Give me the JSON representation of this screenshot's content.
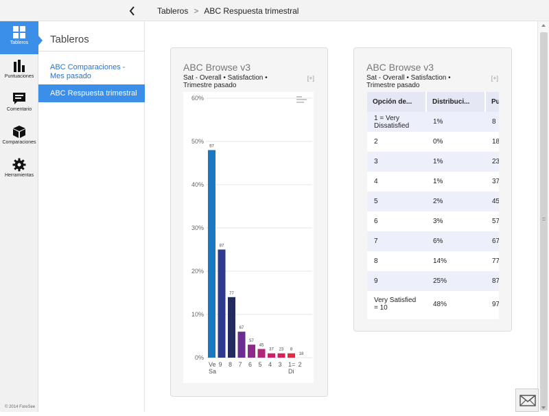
{
  "breadcrumb": {
    "root": "Tableros",
    "sep": ">",
    "current": "ABC Respuesta trimestral"
  },
  "iconbar": {
    "items": [
      {
        "label": "Tableros",
        "icon": "dashboard-icon"
      },
      {
        "label": "Puntuaciones",
        "icon": "bar-chart-icon"
      },
      {
        "label": "Comentario",
        "icon": "comment-icon"
      },
      {
        "label": "Comparaciones",
        "icon": "cube-icon"
      },
      {
        "label": "Herramientas",
        "icon": "gear-icon"
      }
    ],
    "copyright": "© 2014 ForeSee"
  },
  "subnav": {
    "title": "Tableros",
    "items": [
      {
        "label": "ABC Comparaciones - Mes pasado"
      },
      {
        "label": "ABC Respuesta trimestral"
      }
    ]
  },
  "cards": [
    {
      "title": "ABC Browse v3",
      "subtitle": "Sat - Overall • Satisfaction • Trimestre pasado",
      "expand": "[+]"
    },
    {
      "title": "ABC Browse v3",
      "subtitle": "Sat - Overall • Satisfaction • Trimestre pasado",
      "expand": "[+]"
    }
  ],
  "table": {
    "headers": [
      "Opción de...",
      "Distribuci...",
      "Pu"
    ],
    "rows": [
      [
        "1 = Very Dissatisfied",
        "1%",
        "8"
      ],
      [
        "2",
        "0%",
        "18"
      ],
      [
        "3",
        "1%",
        "23"
      ],
      [
        "4",
        "1%",
        "37"
      ],
      [
        "5",
        "2%",
        "45"
      ],
      [
        "6",
        "3%",
        "57"
      ],
      [
        "7",
        "6%",
        "67"
      ],
      [
        "8",
        "14%",
        "77"
      ],
      [
        "9",
        "25%",
        "87"
      ],
      [
        "Very Satisfied = 10",
        "48%",
        "97"
      ]
    ]
  },
  "chart_data": {
    "type": "bar",
    "categories": [
      "Very Satisfied = 10",
      "9",
      "8",
      "7",
      "6",
      "5",
      "4",
      "3",
      "1 = Very Dissatisfied",
      "2"
    ],
    "tick_labels": [
      [
        "Ve",
        "Sa"
      ],
      [
        "9"
      ],
      [
        "8"
      ],
      [
        "7"
      ],
      [
        "6"
      ],
      [
        "5"
      ],
      [
        "4"
      ],
      [
        "3"
      ],
      [
        "1=",
        "Di"
      ],
      [
        "2"
      ]
    ],
    "values": [
      48,
      25,
      14,
      6,
      3,
      2,
      1,
      1,
      1,
      0
    ],
    "bar_labels": [
      "97",
      "87",
      "77",
      "67",
      "57",
      "45",
      "37",
      "23",
      "8",
      "18"
    ],
    "colors": [
      "#1a78c2",
      "#2e3a8c",
      "#222a5e",
      "#6a2c91",
      "#8e2a8c",
      "#b0247a",
      "#cc1f68",
      "#d81f58",
      "#e02a48",
      "#e04040"
    ],
    "yticks": [
      "0%",
      "10%",
      "20%",
      "30%",
      "40%",
      "50%",
      "60%"
    ],
    "ylim": [
      0,
      60
    ],
    "grid": true
  }
}
